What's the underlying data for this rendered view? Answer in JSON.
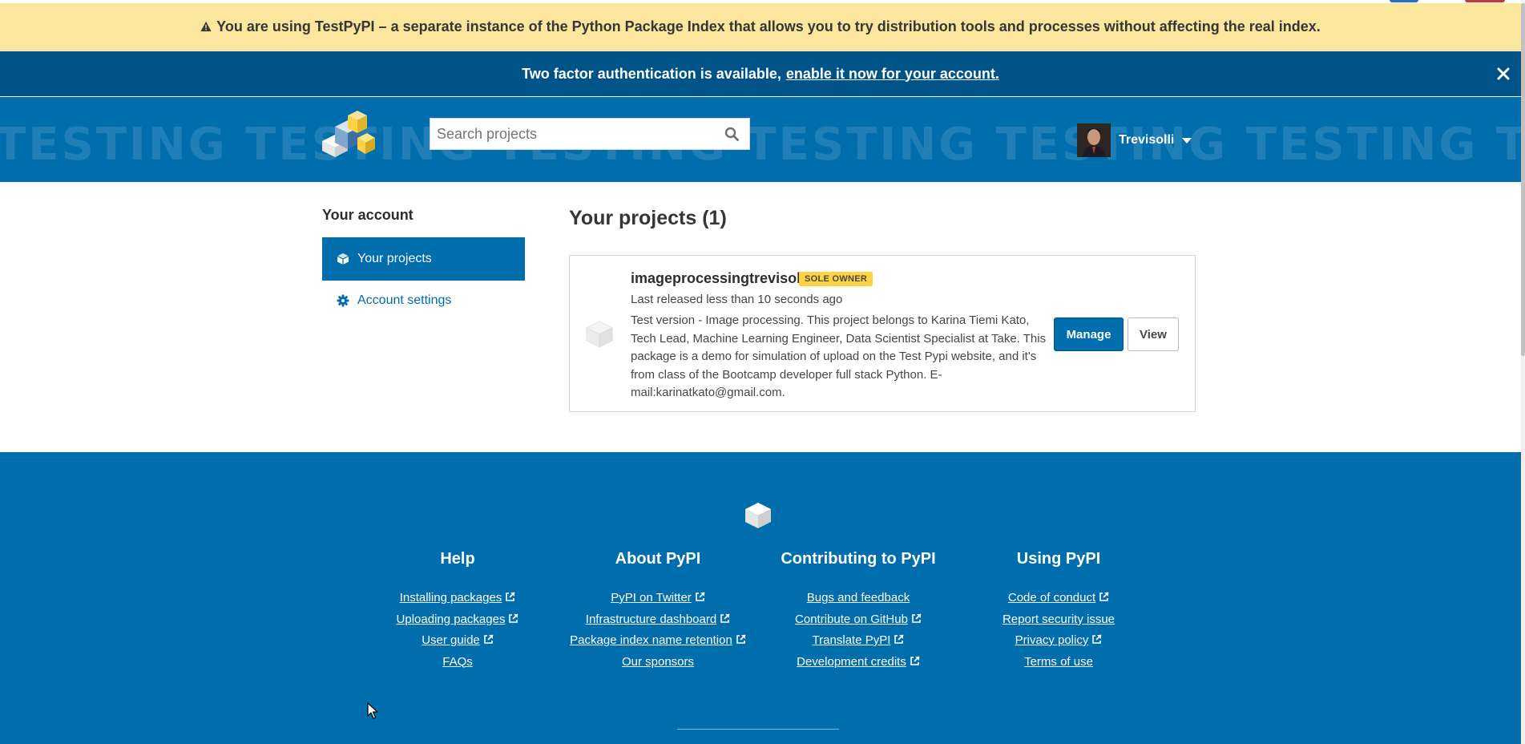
{
  "banner": {
    "test_notice": "You are using TestPyPI – a separate instance of the Python Package Index that allows you to try distribution tools and processes without affecting the real index.",
    "twofa_text": "Two factor authentication is available,",
    "twofa_link": "enable it now for your account."
  },
  "header": {
    "watermark": "TESTING TESTING TESTING TESTING TESTING TESTING TESTING TESTING",
    "search_placeholder": "Search projects",
    "username": "Trevisolli"
  },
  "sidebar": {
    "title": "Your account",
    "items": [
      {
        "label": "Your projects",
        "icon": "cube-icon",
        "active": true
      },
      {
        "label": "Account settings",
        "icon": "gear-icon",
        "active": false
      }
    ]
  },
  "main": {
    "title": "Your projects (1)",
    "projects": [
      {
        "name": "imageprocessingtrevisolli",
        "badge": "SOLE OWNER",
        "released": "Last released less than 10 seconds ago",
        "description": "Test version - Image processing. This project belongs to Karina Tiemi Kato, Tech Lead, Machine Learning Engineer, Data Scientist Specialist at Take. This package is a demo for simulation of upload on the Test Pypi website, and it's from class of the Bootcamp developer full stack Python. E-mail:karinatkato@gmail.com.",
        "manage_label": "Manage",
        "view_label": "View"
      }
    ]
  },
  "footer": {
    "columns": [
      {
        "title": "Help",
        "links": [
          {
            "label": "Installing packages",
            "external": true
          },
          {
            "label": "Uploading packages",
            "external": true
          },
          {
            "label": "User guide",
            "external": true
          },
          {
            "label": "FAQs",
            "external": false
          }
        ]
      },
      {
        "title": "About PyPI",
        "links": [
          {
            "label": "PyPI on Twitter",
            "external": true
          },
          {
            "label": "Infrastructure dashboard",
            "external": true
          },
          {
            "label": "Package index name retention",
            "external": true
          },
          {
            "label": "Our sponsors",
            "external": false
          }
        ]
      },
      {
        "title": "Contributing to PyPI",
        "links": [
          {
            "label": "Bugs and feedback",
            "external": false
          },
          {
            "label": "Contribute on GitHub",
            "external": true
          },
          {
            "label": "Translate PyPI",
            "external": true
          },
          {
            "label": "Development credits",
            "external": true
          }
        ]
      },
      {
        "title": "Using PyPI",
        "links": [
          {
            "label": "Code of conduct",
            "external": true
          },
          {
            "label": "Report security issue",
            "external": false
          },
          {
            "label": "Privacy policy",
            "external": true
          },
          {
            "label": "Terms of use",
            "external": false
          }
        ]
      }
    ]
  },
  "colors": {
    "test_banner_bg": "#fae69c",
    "twofa_banner_bg": "#005387",
    "brand_blue": "#006dad",
    "badge_yellow": "#ffd343"
  }
}
